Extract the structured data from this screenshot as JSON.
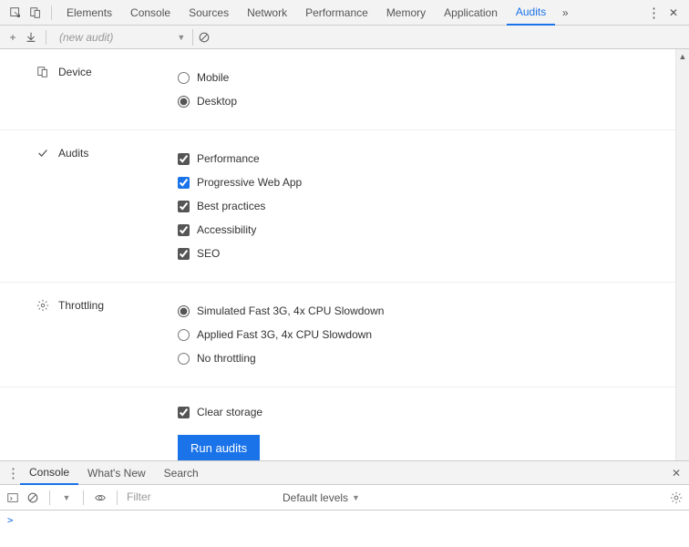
{
  "tabs": {
    "elements": "Elements",
    "console": "Console",
    "sources": "Sources",
    "network": "Network",
    "performance": "Performance",
    "memory": "Memory",
    "application": "Application",
    "audits": "Audits"
  },
  "audit_toolbar": {
    "new_audit": "(new audit)"
  },
  "device": {
    "label": "Device",
    "mobile": "Mobile",
    "desktop": "Desktop"
  },
  "audits": {
    "label": "Audits",
    "performance": "Performance",
    "pwa": "Progressive Web App",
    "best_practices": "Best practices",
    "accessibility": "Accessibility",
    "seo": "SEO"
  },
  "throttling": {
    "label": "Throttling",
    "simulated": "Simulated Fast 3G, 4x CPU Slowdown",
    "applied": "Applied Fast 3G, 4x CPU Slowdown",
    "none": "No throttling"
  },
  "clear_storage": "Clear storage",
  "run_button": "Run audits",
  "drawer": {
    "console": "Console",
    "whats_new": "What's New",
    "search": "Search"
  },
  "console_bar": {
    "filter_placeholder": "Filter",
    "levels": "Default levels"
  },
  "prompt": ">"
}
